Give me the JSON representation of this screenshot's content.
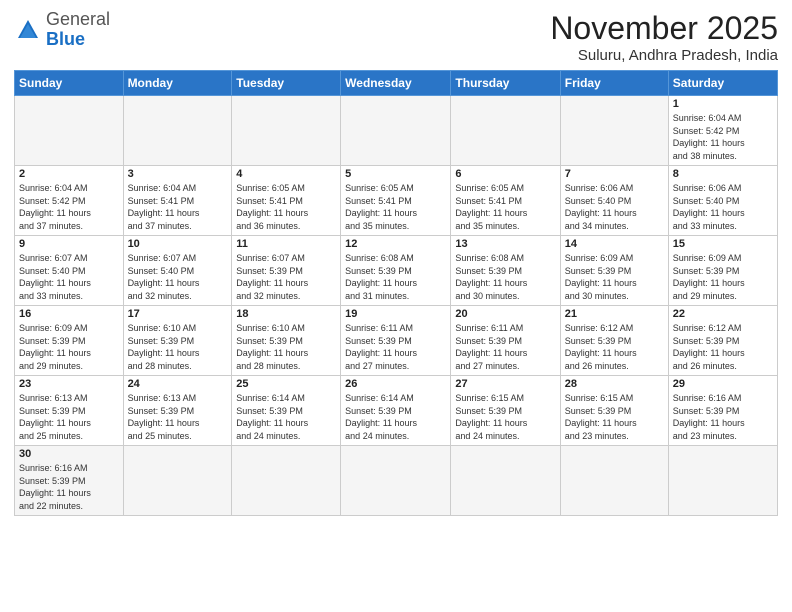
{
  "header": {
    "logo_general": "General",
    "logo_blue": "Blue",
    "month_title": "November 2025",
    "location": "Suluru, Andhra Pradesh, India"
  },
  "weekdays": [
    "Sunday",
    "Monday",
    "Tuesday",
    "Wednesday",
    "Thursday",
    "Friday",
    "Saturday"
  ],
  "weeks": [
    [
      {
        "day": "",
        "info": ""
      },
      {
        "day": "",
        "info": ""
      },
      {
        "day": "",
        "info": ""
      },
      {
        "day": "",
        "info": ""
      },
      {
        "day": "",
        "info": ""
      },
      {
        "day": "",
        "info": ""
      },
      {
        "day": "1",
        "info": "Sunrise: 6:04 AM\nSunset: 5:42 PM\nDaylight: 11 hours\nand 38 minutes."
      }
    ],
    [
      {
        "day": "2",
        "info": "Sunrise: 6:04 AM\nSunset: 5:42 PM\nDaylight: 11 hours\nand 37 minutes."
      },
      {
        "day": "3",
        "info": "Sunrise: 6:04 AM\nSunset: 5:41 PM\nDaylight: 11 hours\nand 37 minutes."
      },
      {
        "day": "4",
        "info": "Sunrise: 6:05 AM\nSunset: 5:41 PM\nDaylight: 11 hours\nand 36 minutes."
      },
      {
        "day": "5",
        "info": "Sunrise: 6:05 AM\nSunset: 5:41 PM\nDaylight: 11 hours\nand 35 minutes."
      },
      {
        "day": "6",
        "info": "Sunrise: 6:05 AM\nSunset: 5:41 PM\nDaylight: 11 hours\nand 35 minutes."
      },
      {
        "day": "7",
        "info": "Sunrise: 6:06 AM\nSunset: 5:40 PM\nDaylight: 11 hours\nand 34 minutes."
      },
      {
        "day": "8",
        "info": "Sunrise: 6:06 AM\nSunset: 5:40 PM\nDaylight: 11 hours\nand 33 minutes."
      }
    ],
    [
      {
        "day": "9",
        "info": "Sunrise: 6:07 AM\nSunset: 5:40 PM\nDaylight: 11 hours\nand 33 minutes."
      },
      {
        "day": "10",
        "info": "Sunrise: 6:07 AM\nSunset: 5:40 PM\nDaylight: 11 hours\nand 32 minutes."
      },
      {
        "day": "11",
        "info": "Sunrise: 6:07 AM\nSunset: 5:39 PM\nDaylight: 11 hours\nand 32 minutes."
      },
      {
        "day": "12",
        "info": "Sunrise: 6:08 AM\nSunset: 5:39 PM\nDaylight: 11 hours\nand 31 minutes."
      },
      {
        "day": "13",
        "info": "Sunrise: 6:08 AM\nSunset: 5:39 PM\nDaylight: 11 hours\nand 30 minutes."
      },
      {
        "day": "14",
        "info": "Sunrise: 6:09 AM\nSunset: 5:39 PM\nDaylight: 11 hours\nand 30 minutes."
      },
      {
        "day": "15",
        "info": "Sunrise: 6:09 AM\nSunset: 5:39 PM\nDaylight: 11 hours\nand 29 minutes."
      }
    ],
    [
      {
        "day": "16",
        "info": "Sunrise: 6:09 AM\nSunset: 5:39 PM\nDaylight: 11 hours\nand 29 minutes."
      },
      {
        "day": "17",
        "info": "Sunrise: 6:10 AM\nSunset: 5:39 PM\nDaylight: 11 hours\nand 28 minutes."
      },
      {
        "day": "18",
        "info": "Sunrise: 6:10 AM\nSunset: 5:39 PM\nDaylight: 11 hours\nand 28 minutes."
      },
      {
        "day": "19",
        "info": "Sunrise: 6:11 AM\nSunset: 5:39 PM\nDaylight: 11 hours\nand 27 minutes."
      },
      {
        "day": "20",
        "info": "Sunrise: 6:11 AM\nSunset: 5:39 PM\nDaylight: 11 hours\nand 27 minutes."
      },
      {
        "day": "21",
        "info": "Sunrise: 6:12 AM\nSunset: 5:39 PM\nDaylight: 11 hours\nand 26 minutes."
      },
      {
        "day": "22",
        "info": "Sunrise: 6:12 AM\nSunset: 5:39 PM\nDaylight: 11 hours\nand 26 minutes."
      }
    ],
    [
      {
        "day": "23",
        "info": "Sunrise: 6:13 AM\nSunset: 5:39 PM\nDaylight: 11 hours\nand 25 minutes."
      },
      {
        "day": "24",
        "info": "Sunrise: 6:13 AM\nSunset: 5:39 PM\nDaylight: 11 hours\nand 25 minutes."
      },
      {
        "day": "25",
        "info": "Sunrise: 6:14 AM\nSunset: 5:39 PM\nDaylight: 11 hours\nand 24 minutes."
      },
      {
        "day": "26",
        "info": "Sunrise: 6:14 AM\nSunset: 5:39 PM\nDaylight: 11 hours\nand 24 minutes."
      },
      {
        "day": "27",
        "info": "Sunrise: 6:15 AM\nSunset: 5:39 PM\nDaylight: 11 hours\nand 24 minutes."
      },
      {
        "day": "28",
        "info": "Sunrise: 6:15 AM\nSunset: 5:39 PM\nDaylight: 11 hours\nand 23 minutes."
      },
      {
        "day": "29",
        "info": "Sunrise: 6:16 AM\nSunset: 5:39 PM\nDaylight: 11 hours\nand 23 minutes."
      }
    ],
    [
      {
        "day": "30",
        "info": "Sunrise: 6:16 AM\nSunset: 5:39 PM\nDaylight: 11 hours\nand 22 minutes.",
        "last": true
      },
      {
        "day": "",
        "info": "",
        "last": true
      },
      {
        "day": "",
        "info": "",
        "last": true
      },
      {
        "day": "",
        "info": "",
        "last": true
      },
      {
        "day": "",
        "info": "",
        "last": true
      },
      {
        "day": "",
        "info": "",
        "last": true
      },
      {
        "day": "",
        "info": "",
        "last": true
      }
    ]
  ]
}
